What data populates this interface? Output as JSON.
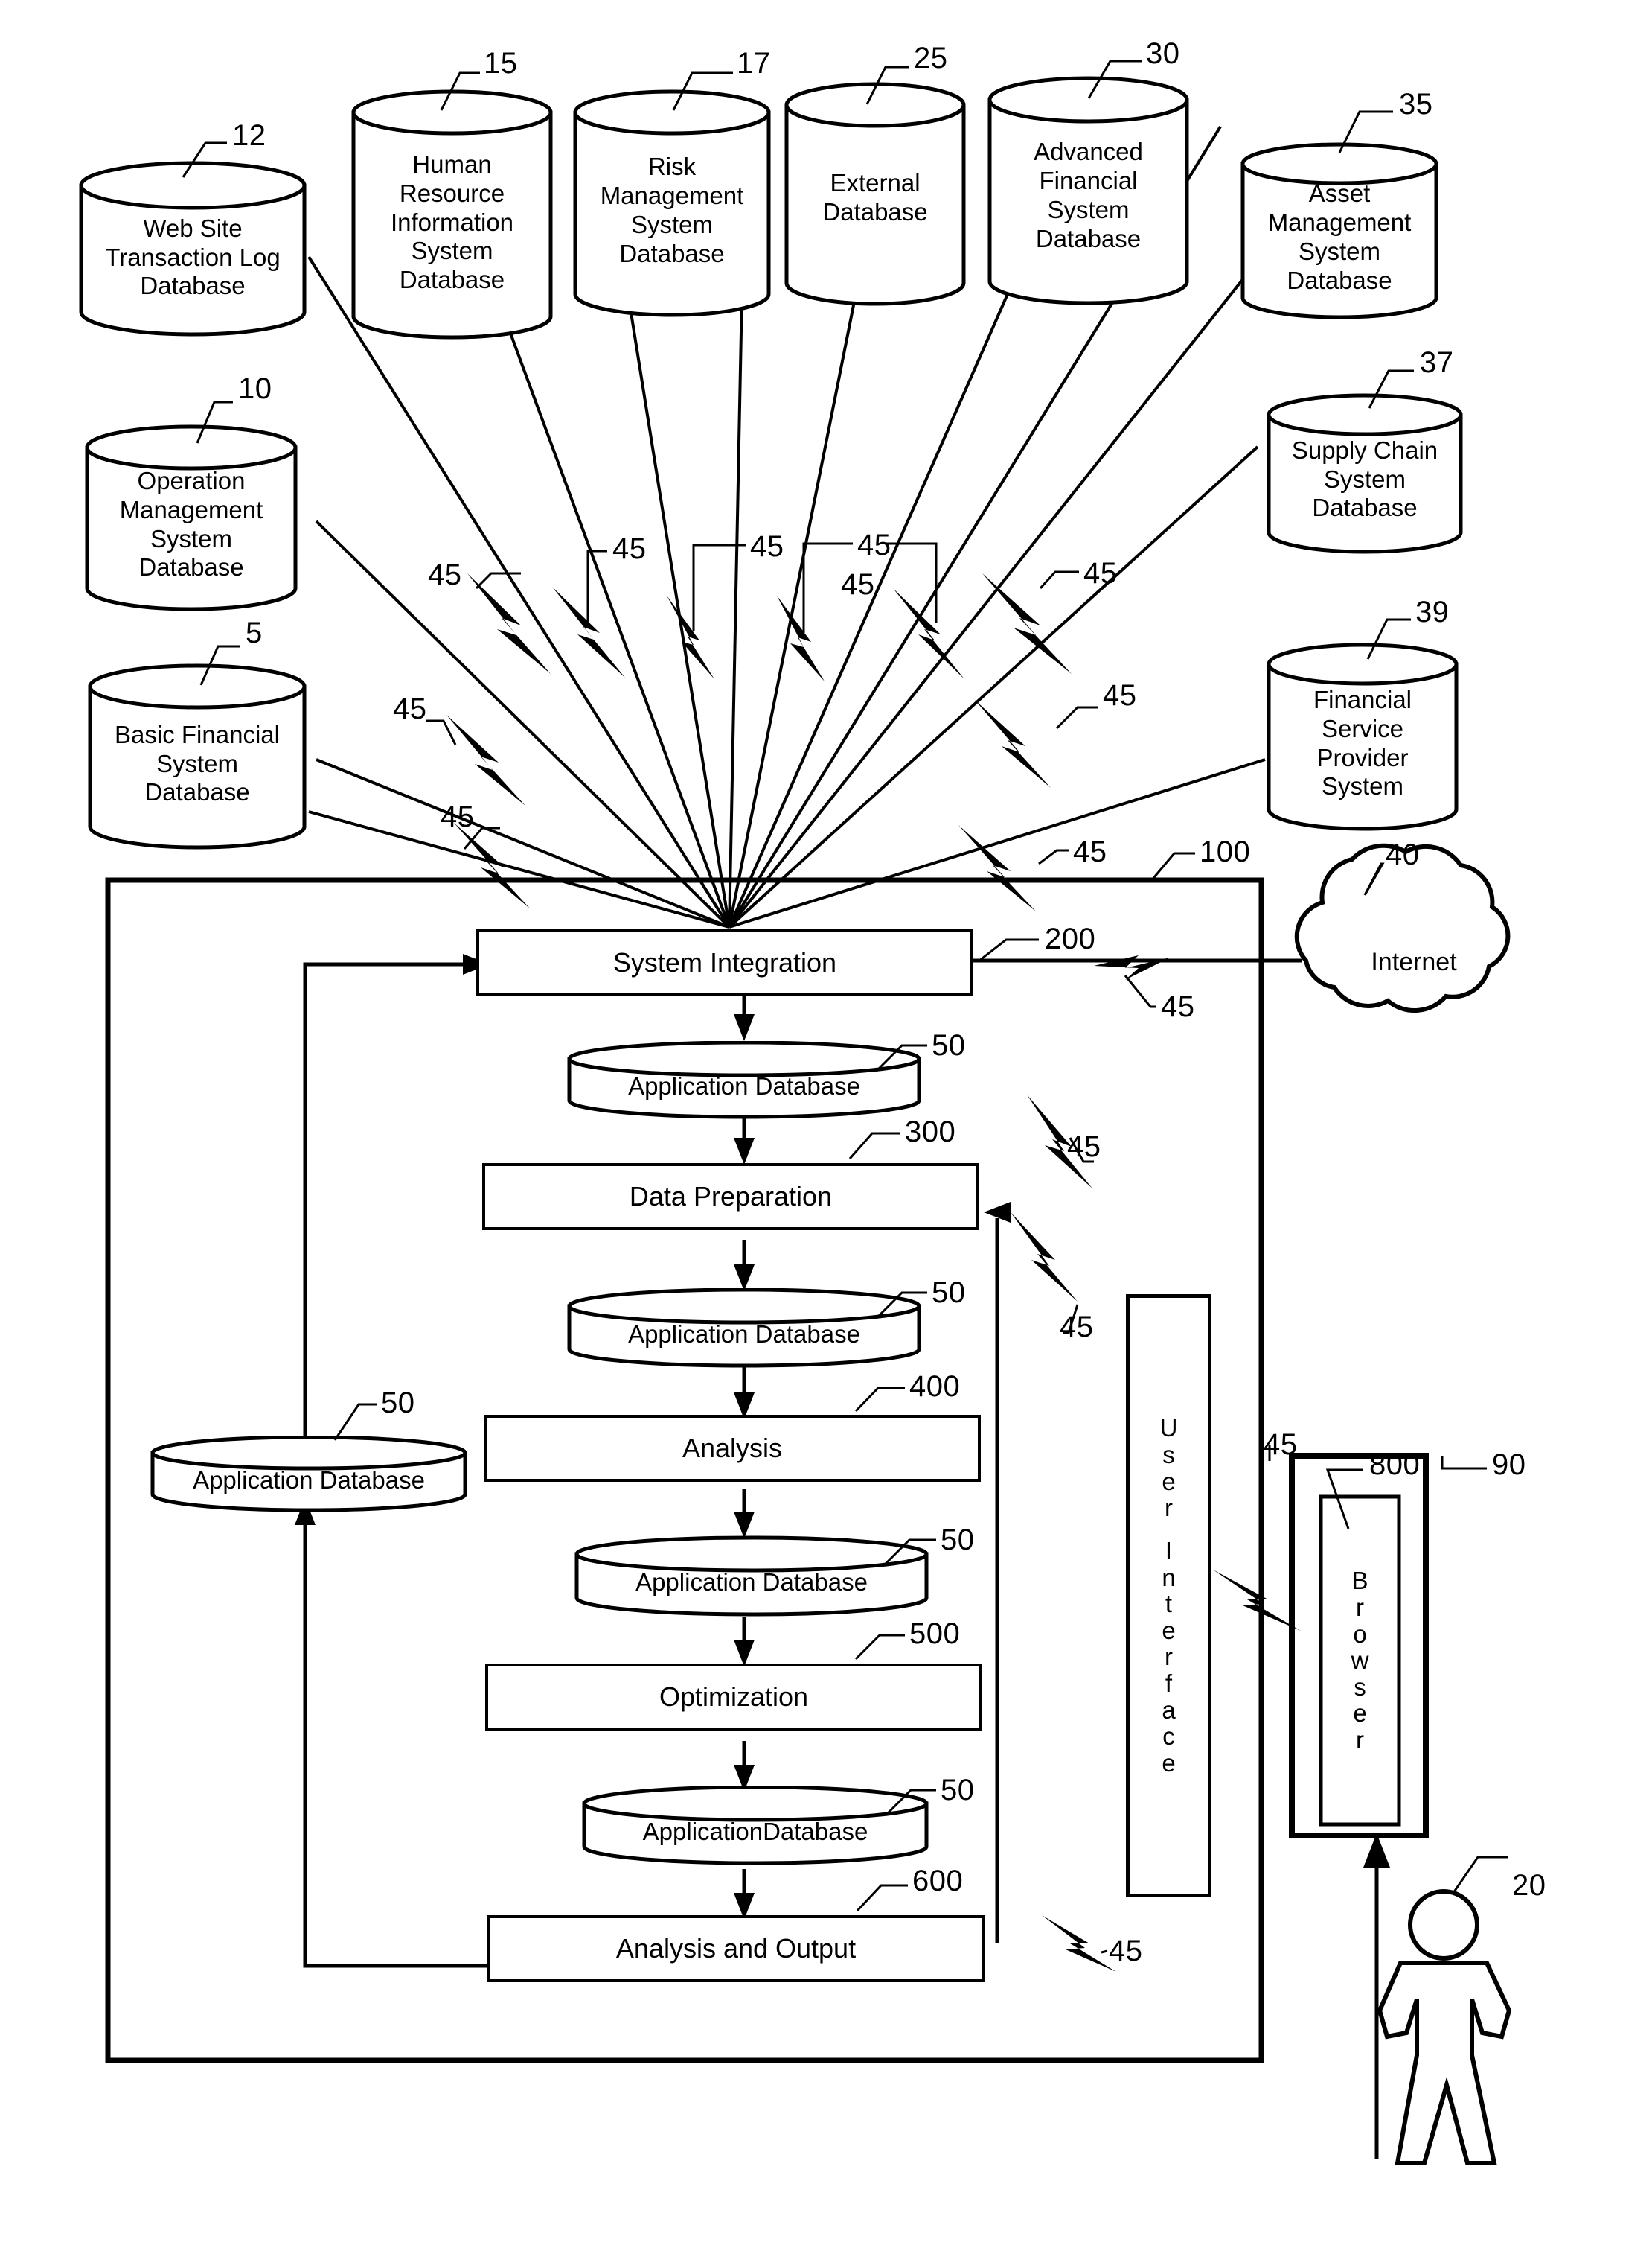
{
  "figure": {
    "type": "patent-system-architecture-diagram",
    "title": "",
    "stroke_color": "#000000",
    "background_color": "#ffffff"
  },
  "source_databases": [
    {
      "id": "web-site-transaction-log",
      "ref": "12",
      "lines": [
        "Web Site",
        "Transaction Log",
        "Database"
      ]
    },
    {
      "id": "human-resource-information-system",
      "ref": "15",
      "lines": [
        "Human",
        "Resource",
        "Information",
        "System",
        "Database"
      ]
    },
    {
      "id": "risk-management-system",
      "ref": "17",
      "lines": [
        "Risk",
        "Management",
        "System",
        "Database"
      ]
    },
    {
      "id": "external-database",
      "ref": "25",
      "lines": [
        "External",
        "Database"
      ]
    },
    {
      "id": "advanced-financial-system",
      "ref": "30",
      "lines": [
        "Advanced",
        "Financial",
        "System",
        "Database"
      ]
    },
    {
      "id": "asset-management-system",
      "ref": "35",
      "lines": [
        "Asset",
        "Management",
        "System",
        "Database"
      ]
    },
    {
      "id": "operation-management-system",
      "ref": "10",
      "lines": [
        "Operation",
        "Management",
        "System",
        "Database"
      ]
    },
    {
      "id": "supply-chain-system",
      "ref": "37",
      "lines": [
        "Supply Chain",
        "System",
        "Database"
      ]
    },
    {
      "id": "basic-financial-system",
      "ref": "5",
      "lines": [
        "Basic Financial",
        "System",
        "Database"
      ]
    },
    {
      "id": "financial-service-provider-system",
      "ref": "39",
      "lines": [
        "Financial",
        "Service",
        "Provider",
        "System"
      ]
    }
  ],
  "network": {
    "cloud_label": "Internet",
    "cloud_ref": "40",
    "connector_ref": "45",
    "connector_count": 13
  },
  "system": {
    "ref": "100",
    "blocks": [
      {
        "id": "system-integration",
        "label": "System Integration",
        "ref": "200"
      },
      {
        "id": "data-preparation",
        "label": "Data Preparation",
        "ref": "300"
      },
      {
        "id": "analysis",
        "label": "Analysis",
        "ref": "400"
      },
      {
        "id": "optimization",
        "label": "Optimization",
        "ref": "500"
      },
      {
        "id": "analysis-and-output",
        "label": "Analysis and Output",
        "ref": "600"
      }
    ],
    "application_databases": [
      {
        "id": "adb-after-integration",
        "label": "Application Database",
        "ref": "50"
      },
      {
        "id": "adb-after-preparation",
        "label": "Application Database",
        "ref": "50"
      },
      {
        "id": "adb-after-analysis",
        "label": "Application Database",
        "ref": "50"
      },
      {
        "id": "adb-after-optimization",
        "label": "ApplicationDatabase",
        "ref": "50"
      },
      {
        "id": "adb-feedback-left",
        "label": "Application Database",
        "ref": "50"
      }
    ],
    "user_interface": {
      "label": "User Interface",
      "letters": [
        "U",
        "s",
        "e",
        "r",
        "",
        "I",
        "n",
        "t",
        "e",
        "r",
        "f",
        "a",
        "c",
        "e"
      ]
    }
  },
  "client": {
    "outer_ref": "90",
    "browser_ref": "800",
    "browser_label": "Browser",
    "browser_letters": [
      "B",
      "r",
      "o",
      "w",
      "s",
      "e",
      "r"
    ],
    "user_ref": "20"
  },
  "reference_numerals": [
    "5",
    "10",
    "12",
    "15",
    "17",
    "20",
    "25",
    "30",
    "35",
    "37",
    "39",
    "40",
    "45",
    "50",
    "90",
    "100",
    "200",
    "300",
    "400",
    "500",
    "600",
    "800"
  ]
}
